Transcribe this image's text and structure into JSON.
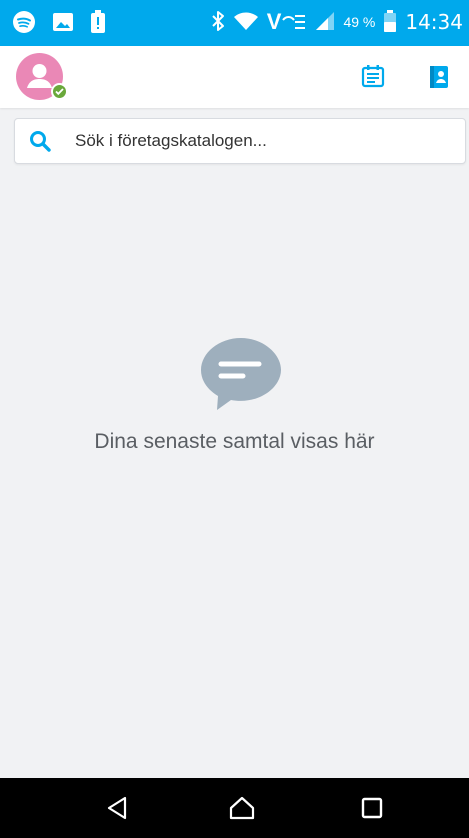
{
  "status_bar": {
    "time": "14:34",
    "battery_percent": "49 %",
    "network_label": "V",
    "icons": [
      "spotify-icon",
      "gallery-icon",
      "battery-alert-icon",
      "bluetooth-icon",
      "wifi-icon",
      "volte-icon",
      "signal-icon",
      "battery-icon"
    ]
  },
  "app_bar": {
    "presence_status": "available",
    "accent_color": "#00a9ec",
    "icons": [
      "avatar-icon",
      "dial-pad-icon",
      "contacts-icon"
    ]
  },
  "search": {
    "placeholder": "Sök i företagskatalogen..."
  },
  "empty_state": {
    "message": "Dina senaste samtal visas här",
    "icon": "chat-bubble-icon"
  },
  "nav_bar": {
    "buttons": [
      "back-icon",
      "home-icon",
      "recents-icon"
    ]
  }
}
